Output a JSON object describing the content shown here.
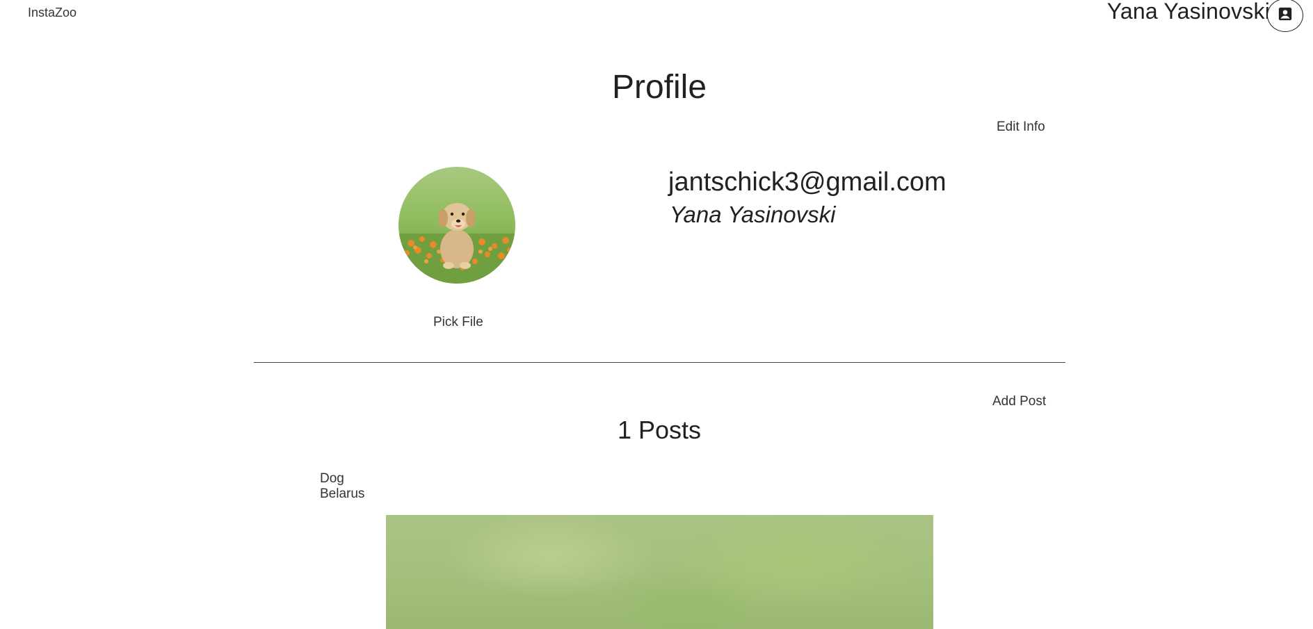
{
  "header": {
    "brand": "InstaZoo",
    "user_name": "Yana Yasinovski",
    "account_icon": "account-box-icon"
  },
  "profile": {
    "title": "Profile",
    "edit_label": "Edit Info",
    "email": "jantschick3@gmail.com",
    "full_name": "Yana Yasinovski",
    "pick_file_label": "Pick File",
    "avatar_alt": "puppy-on-grass-image"
  },
  "posts": {
    "add_label": "Add Post",
    "count_label": "1 Posts",
    "items": [
      {
        "title": "Dog",
        "location": "Belarus"
      }
    ]
  },
  "colors": {
    "text": "#212121",
    "divider": "#444444",
    "background": "#ffffff"
  }
}
